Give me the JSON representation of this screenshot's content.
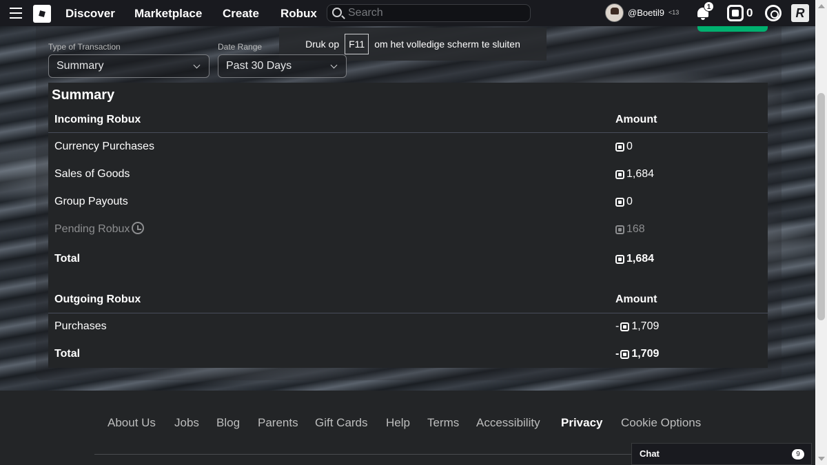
{
  "header": {
    "nav": [
      "Discover",
      "Marketplace",
      "Create",
      "Robux"
    ],
    "search_placeholder": "Search",
    "username": "@Boetil9",
    "age_tag": "<13",
    "notification_count": "1",
    "robux_balance": "0",
    "rx_logo": "R"
  },
  "toast": {
    "prefix": "Druk op",
    "key": "F11",
    "suffix": "om het volledige scherm te sluiten"
  },
  "filters": {
    "type_label": "Type of Transaction",
    "type_value": "Summary",
    "date_label": "Date Range",
    "date_value": "Past 30 Days"
  },
  "summary": {
    "title": "Summary",
    "incoming_header": "Incoming Robux",
    "amount_header": "Amount",
    "incoming": [
      {
        "label": "Currency Purchases",
        "amount": "0"
      },
      {
        "label": "Sales of Goods",
        "amount": "1,684"
      },
      {
        "label": "Group Payouts",
        "amount": "0"
      }
    ],
    "pending_label": "Pending Robux",
    "pending_amount": "168",
    "incoming_total_label": "Total",
    "incoming_total": "1,684",
    "outgoing_header": "Outgoing Robux",
    "outgoing_amount_header": "Amount",
    "outgoing_sign": "-",
    "purchases_label": "Purchases",
    "purchases_amount": "1,709",
    "outgoing_total_label": "Total",
    "outgoing_total": "1,709"
  },
  "footer": {
    "links": [
      "About Us",
      "Jobs",
      "Blog",
      "Parents",
      "Gift Cards",
      "Help",
      "Terms",
      "Accessibility",
      "Privacy",
      "Cookie Options"
    ]
  },
  "chat": {
    "label": "Chat",
    "count": "9"
  },
  "colors": {
    "accent_green": "#00b06f",
    "topbar": "#191a1f",
    "panel": "#232527"
  }
}
